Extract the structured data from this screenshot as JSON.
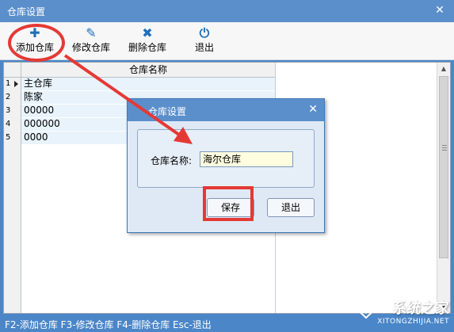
{
  "window": {
    "title": "仓库设置",
    "close_glyph": "✕"
  },
  "toolbar": {
    "buttons": [
      {
        "label": "添加仓库",
        "icon": "plus-icon",
        "glyph": "✚"
      },
      {
        "label": "修改仓库",
        "icon": "pencil-icon",
        "glyph": "✎"
      },
      {
        "label": "删除仓库",
        "icon": "x-icon",
        "glyph": "✖"
      },
      {
        "label": "退出",
        "icon": "power-icon",
        "glyph": "⏻"
      }
    ]
  },
  "grid": {
    "column_header": "仓库名称",
    "rows": [
      {
        "num": "1",
        "name": "主仓库"
      },
      {
        "num": "2",
        "name": "陈家"
      },
      {
        "num": "3",
        "name": "00000"
      },
      {
        "num": "4",
        "name": "000000"
      },
      {
        "num": "5",
        "name": "0000"
      }
    ]
  },
  "status_bar": {
    "text": "F2-添加仓库 F3-修改仓库 F4-删除仓库 Esc-退出"
  },
  "dialog": {
    "title": "仓库设置",
    "close_glyph": "✕",
    "field_label": "仓库名称:",
    "field_value": "海尔仓库",
    "save_label": "保存",
    "exit_label": "退出"
  },
  "watermark": {
    "brand": "系统之家",
    "site": "XITONGZHIJIA.NET"
  },
  "colors": {
    "title_bar": "#5b8fcb",
    "accent_icon": "#1f6fb9",
    "highlight": "#e53935",
    "input_bg": "#fffde0"
  }
}
